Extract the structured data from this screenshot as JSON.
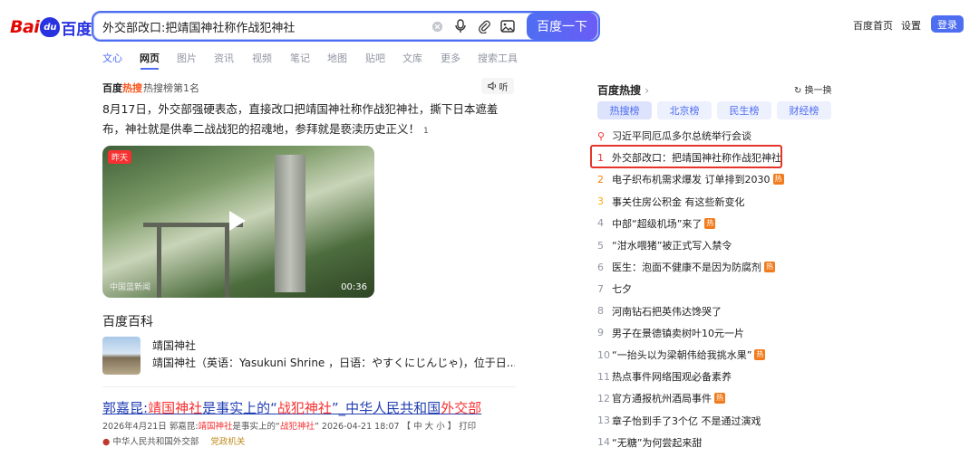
{
  "header": {
    "logo_latin": "Bai",
    "logo_paw": "du",
    "logo_cn": "百度",
    "search_value": "外交部改口:把靖国神社称作战犯神社",
    "search_button": "百度一下",
    "links": [
      "百度首页",
      "设置"
    ],
    "login": "登录"
  },
  "tabs": [
    "文心",
    "网页",
    "图片",
    "资讯",
    "视频",
    "笔记",
    "地图",
    "贴吧",
    "文库",
    "更多",
    "搜索工具"
  ],
  "hot_card": {
    "logo_a": "百度",
    "logo_b": "热搜",
    "rank": "热搜榜第1名",
    "listen": "听",
    "snippet": "8月17日，外交部强硬表态，直接改口把靖国神社称作战犯神社，撕下日本遮羞布，神社就是供奉二战战犯的招魂地，参拜就是亵渎历史正义！",
    "ref": "1",
    "video": {
      "tag": "昨天",
      "source": "中国蓝新闻",
      "duration": "00:36"
    }
  },
  "baike": {
    "section_title": "百度百科",
    "name": "靖国神社",
    "desc": "靖国神社（英语：Yasukuni Shrine ，日语：やすくにじんじゃ)，位于日..."
  },
  "result": {
    "title_a": "郭嘉昆:",
    "title_b": "靖国神社",
    "title_c": "是事实上的“",
    "title_d": "战犯神社",
    "title_e": "”_中华人民共和国",
    "title_f": "外交部",
    "meta_a": "2026年4月21日  郭嘉昆:",
    "meta_b": "靖国神社",
    "meta_c": "是事实上的“",
    "meta_d": "战犯神社",
    "meta_e": "” 2026-04-21 18:07 【 中 大 小 】 打印",
    "source": "中华人民共和国外交部",
    "badge": "党政机关"
  },
  "hot_list": {
    "title": "百度热搜",
    "refresh": "换一换",
    "chips": [
      "热搜榜",
      "北京榜",
      "民生榜",
      "财经榜"
    ],
    "hot_badge": "热",
    "items": [
      {
        "n": "",
        "text": "习近平同厄瓜多尔总统举行会谈",
        "hot": false,
        "pinned": true
      },
      {
        "n": "1",
        "text": "外交部改口：把靖国神社称作战犯神社",
        "hot": false
      },
      {
        "n": "2",
        "text": "电子织布机需求爆发 订单排到2030",
        "hot": true
      },
      {
        "n": "3",
        "text": "事关住房公积金 有这些新变化",
        "hot": false
      },
      {
        "n": "4",
        "text": "中部“超级机场”来了",
        "hot": true
      },
      {
        "n": "5",
        "text": "“泔水喂猪”被正式写入禁令",
        "hot": false
      },
      {
        "n": "6",
        "text": "医生：泡面不健康不是因为防腐剂",
        "hot": true
      },
      {
        "n": "7",
        "text": "七夕",
        "hot": false
      },
      {
        "n": "8",
        "text": "河南钻石把英伟达馋哭了",
        "hot": false
      },
      {
        "n": "9",
        "text": "男子在景德镇卖树叶10元一片",
        "hot": false
      },
      {
        "n": "10",
        "text": "“一抬头以为梁朝伟给我挑水果”",
        "hot": true
      },
      {
        "n": "11",
        "text": "热点事件网络围观必备素养",
        "hot": false
      },
      {
        "n": "12",
        "text": "官方通报杭州酒局事件",
        "hot": true
      },
      {
        "n": "13",
        "text": "章子怡到手了3个亿 不是通过演戏",
        "hot": false
      },
      {
        "n": "14",
        "text": "“无糖”为何尝起来甜",
        "hot": false
      }
    ]
  },
  "colors": {
    "accent": "#4e6ef2",
    "red": "#f73131",
    "hot_badge": "#f27c1d",
    "highlight_box": "#e5352b"
  }
}
